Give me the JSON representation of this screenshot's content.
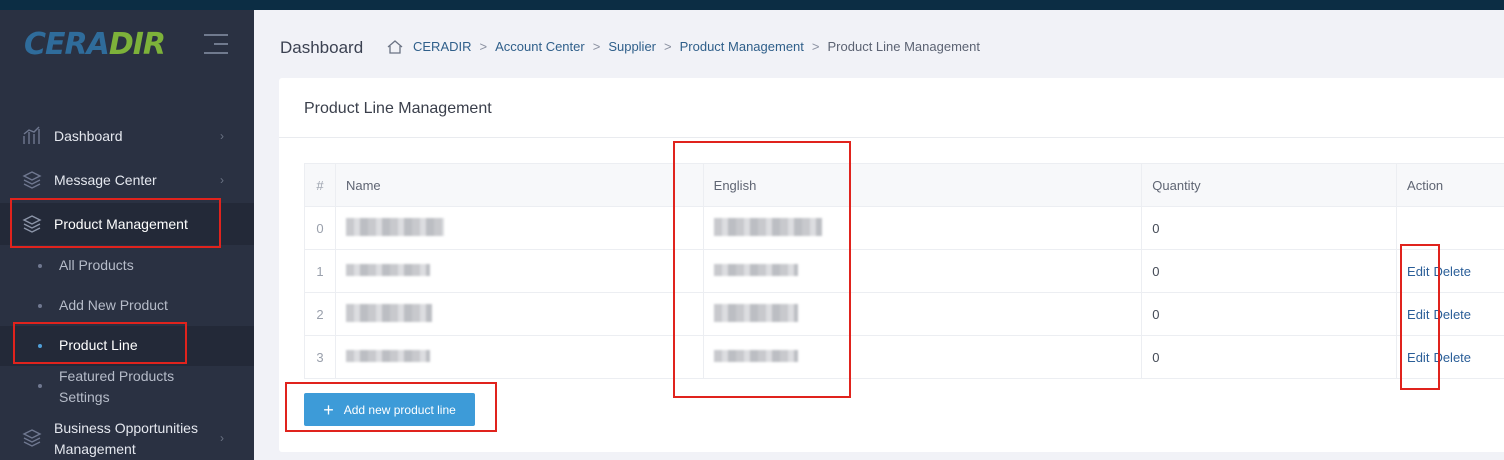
{
  "logo": {
    "part1": "CERA",
    "part2": "DIR"
  },
  "sidebar": {
    "items": [
      {
        "label": "Dashboard",
        "icon": "chart-icon"
      },
      {
        "label": "Message Center",
        "icon": "layers-icon"
      },
      {
        "label": "Product Management",
        "icon": "layers-icon"
      },
      {
        "label": "Business Opportunities",
        "label2": "Management",
        "icon": "layers-icon"
      }
    ],
    "sub_items": [
      {
        "label": "All Products"
      },
      {
        "label": "Add New Product"
      },
      {
        "label": "Product Line"
      },
      {
        "label": "Featured Products",
        "label2": "Settings"
      }
    ]
  },
  "header": {
    "title": "Dashboard",
    "breadcrumb": [
      "CERADIR",
      "Account Center",
      "Supplier",
      "Product Management",
      "Product Line Management"
    ]
  },
  "card": {
    "title": "Product Line Management"
  },
  "table": {
    "columns": [
      "#",
      "Name",
      "English",
      "Quantity",
      "Action"
    ],
    "rows": [
      {
        "idx": "0",
        "quantity": "0",
        "edit": "",
        "delete": ""
      },
      {
        "idx": "1",
        "quantity": "0",
        "edit": "Edit",
        "delete": "Delete"
      },
      {
        "idx": "2",
        "quantity": "0",
        "edit": "Edit",
        "delete": "Delete"
      },
      {
        "idx": "3",
        "quantity": "0",
        "edit": "Edit",
        "delete": "Delete"
      }
    ]
  },
  "add_button": {
    "label": "Add new product line"
  },
  "colors": {
    "accent": "#3d9bd8",
    "sidebar": "#2a3142",
    "highlight": "#e0231d"
  }
}
